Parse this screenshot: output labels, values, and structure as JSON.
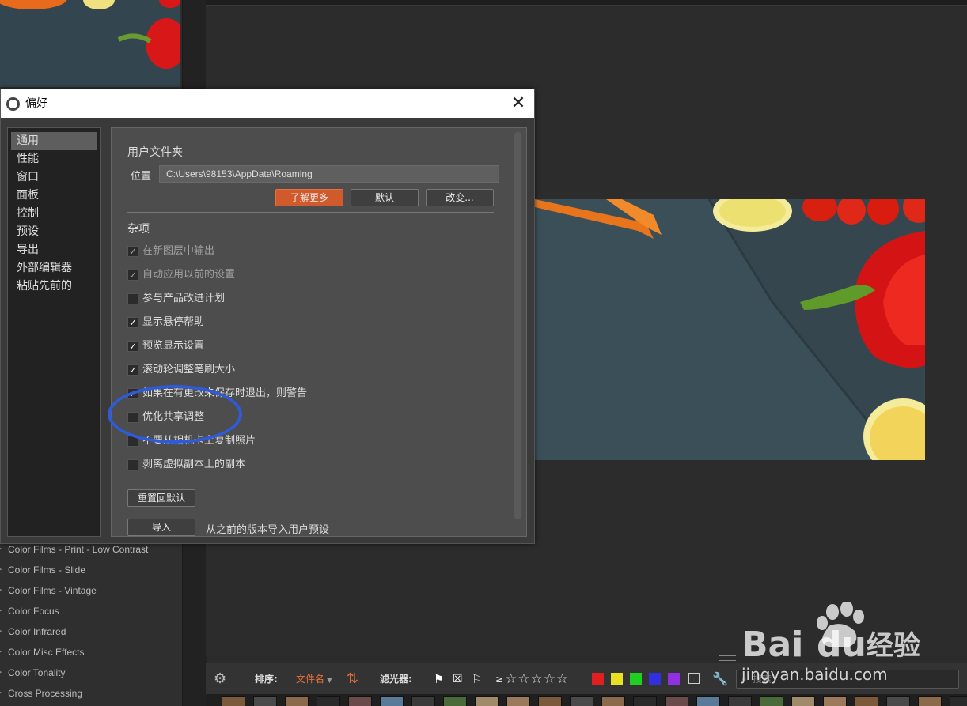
{
  "dialog": {
    "title": "偏好",
    "nav_items": [
      "通用",
      "性能",
      "窗口",
      "面板",
      "控制",
      "预设",
      "导出",
      "外部编辑器",
      "粘贴先前的"
    ],
    "user_folder": {
      "section_title": "用户文件夹",
      "location_label": "位置",
      "location_value": "C:\\Users\\98153\\AppData\\Roaming",
      "learn_more": "了解更多",
      "default": "默认",
      "change": "改变..."
    },
    "misc": {
      "section_title": "杂项",
      "options": [
        {
          "label": "在新图层中输出",
          "checked": true,
          "disabled": true
        },
        {
          "label": "自动应用以前的设置",
          "checked": true,
          "disabled": true
        },
        {
          "label": "参与产品改进计划",
          "checked": false,
          "disabled": false
        },
        {
          "label": "显示悬停帮助",
          "checked": true,
          "disabled": false
        },
        {
          "label": "预览显示设置",
          "checked": true,
          "disabled": false
        },
        {
          "label": "滚动轮调整笔刷大小",
          "checked": true,
          "disabled": false
        },
        {
          "label": "如果在有更改未保存时退出，则警告",
          "checked": true,
          "disabled": false
        },
        {
          "label": "优化共享调整",
          "checked": false,
          "disabled": false
        },
        {
          "label": "不要从相机卡上复制照片",
          "checked": false,
          "disabled": false
        },
        {
          "label": "剥离虚拟副本上的副本",
          "checked": false,
          "disabled": false
        }
      ],
      "reset_defaults": "重置回默认",
      "import": "导入",
      "import_desc": "从之前的版本导入用户预设"
    }
  },
  "presets": [
    "Color Films - Print - Low Contrast",
    "Color Films - Slide",
    "Color Films - Vintage",
    "Color Focus",
    "Color Infrared",
    "Color Misc Effects",
    "Color Tonality",
    "Cross Processing"
  ],
  "toolbar": {
    "sort_label": "排序:",
    "sort_value": "文件名",
    "filter_label": "滤光器:",
    "rating_op": "≥",
    "stars": "☆☆☆☆☆",
    "search_placeholder": "搜索",
    "color_labels": [
      "#e02020",
      "#e8e020",
      "#20d020",
      "#3030e0",
      "#9030e0"
    ]
  },
  "watermark": {
    "brand": "Bai",
    "brand2": "du",
    "suffix": "经验",
    "url": "jingyan.baidu.com"
  }
}
